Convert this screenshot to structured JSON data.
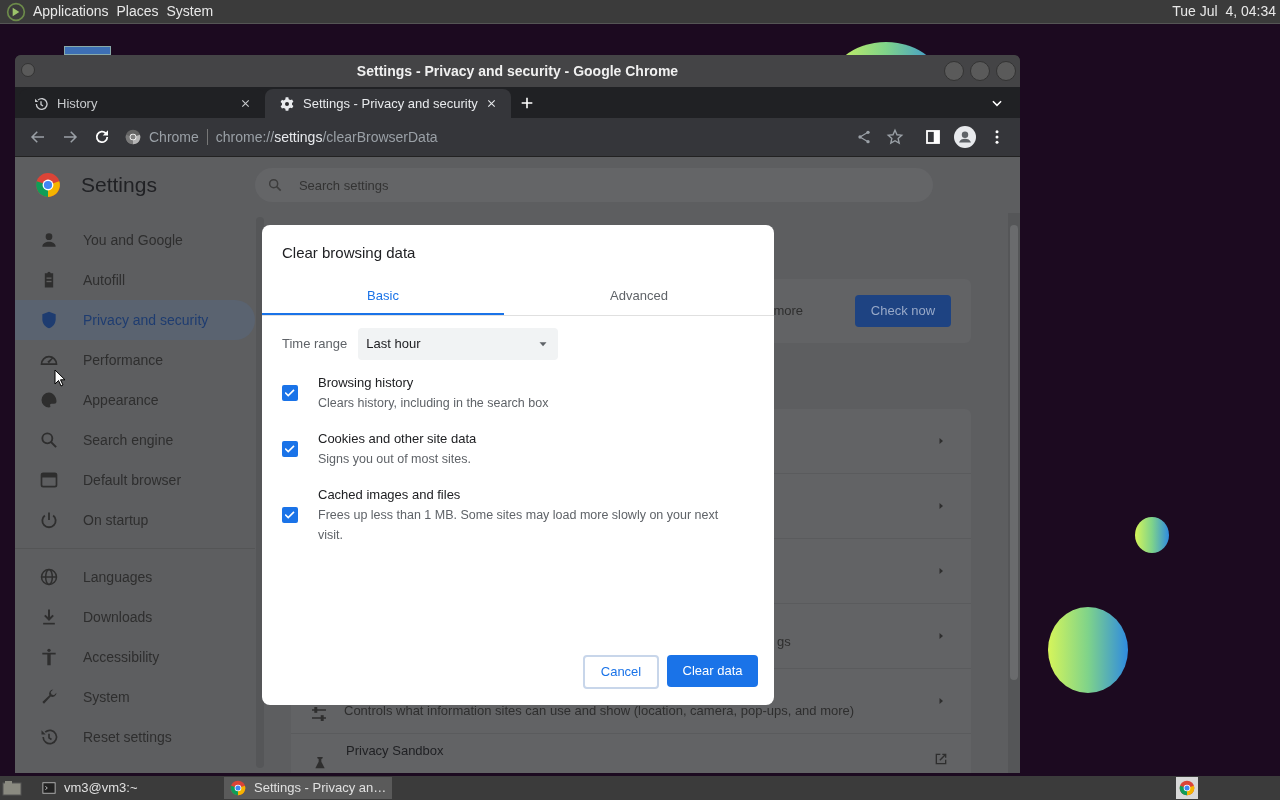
{
  "top_panel": {
    "menus": [
      "Applications",
      "Places",
      "System"
    ],
    "clock": "Tue Jul  4, 04:34"
  },
  "window": {
    "title": "Settings - Privacy and security - Google Chrome",
    "tabs": [
      {
        "label": "History",
        "selected": false
      },
      {
        "label": "Settings - Privacy and security",
        "selected": true
      }
    ],
    "address": {
      "chip": "Chrome",
      "url": "chrome://**settings**/clearBrowserData"
    }
  },
  "settings": {
    "title": "Settings",
    "search": {
      "placeholder": "Search settings"
    },
    "sidebar_groups": [
      [
        {
          "label": "You and Google",
          "selected": false
        },
        {
          "label": "Autofill",
          "selected": false
        },
        {
          "label": "Privacy and security",
          "selected": true
        },
        {
          "label": "Performance",
          "selected": false
        },
        {
          "label": "Appearance",
          "selected": false
        },
        {
          "label": "Search engine",
          "selected": false
        },
        {
          "label": "Default browser",
          "selected": false
        },
        {
          "label": "On startup",
          "selected": false
        }
      ],
      [
        {
          "label": "Languages",
          "selected": false
        },
        {
          "label": "Downloads",
          "selected": false
        },
        {
          "label": "Accessibility",
          "selected": false
        },
        {
          "label": "System",
          "selected": false
        },
        {
          "label": "Reset settings",
          "selected": false
        }
      ]
    ],
    "behind": {
      "card_text": "more",
      "card_button": "Check now",
      "row_fragment": "gs",
      "row_description": "Controls what information sites can use and show (location, camera, pop-ups, and more)",
      "row_title": "Privacy Sandbox"
    }
  },
  "dialog": {
    "title": "Clear browsing data",
    "tabs": [
      {
        "label": "Basic",
        "selected": true
      },
      {
        "label": "Advanced",
        "selected": false
      }
    ],
    "time_range": {
      "label": "Time range",
      "value": "Last hour"
    },
    "options": [
      {
        "title": "Browsing history",
        "description": "Clears history, including in the search box",
        "checked": true
      },
      {
        "title": "Cookies and other site data",
        "description": "Signs you out of most sites.",
        "checked": true
      },
      {
        "title": "Cached images and files",
        "description": "Frees up less than 1 MB. Some sites may load more slowly on your next visit.",
        "checked": true
      }
    ],
    "buttons": {
      "cancel": "Cancel",
      "confirm": "Clear data"
    }
  },
  "taskbar": {
    "items": [
      {
        "label": "vm3@vm3:~",
        "selected": false
      },
      {
        "label": "Settings - Privacy an…",
        "selected": true
      }
    ]
  }
}
